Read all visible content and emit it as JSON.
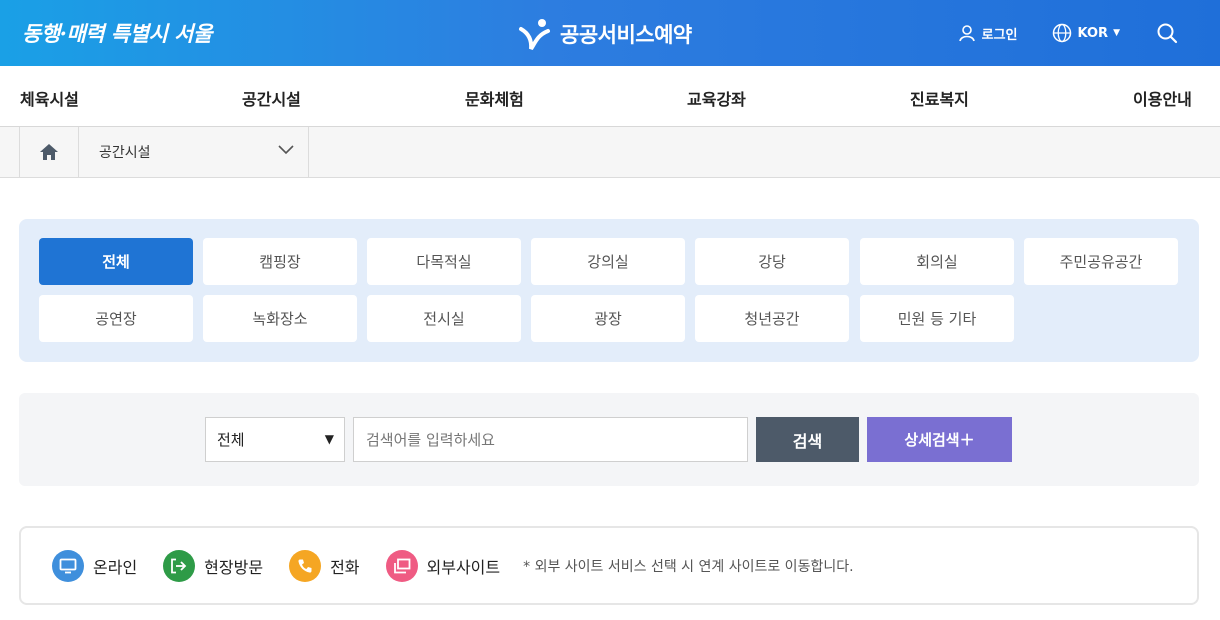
{
  "header": {
    "slogan": "동행·매력 특별시 서울",
    "brand": "공공서비스예약",
    "login": "로그인",
    "language": "KOR"
  },
  "gnb": [
    "체육시설",
    "공간시설",
    "문화체험",
    "교육강좌",
    "진료복지",
    "이용안내"
  ],
  "breadcrumb": {
    "current": "공간시설"
  },
  "categories": {
    "row1": [
      "전체",
      "캠핑장",
      "다목적실",
      "강의실",
      "강당",
      "회의실",
      "주민공유공간"
    ],
    "row2": [
      "공연장",
      "녹화장소",
      "전시실",
      "광장",
      "청년공간",
      "민원 등 기타"
    ],
    "active": "전체"
  },
  "search": {
    "select_value": "전체",
    "placeholder": "검색어를 입력하세요",
    "search_label": "검색",
    "detail_label": "상세검색＋"
  },
  "legend": {
    "online": "온라인",
    "visit": "현장방문",
    "phone": "전화",
    "external": "외부사이트",
    "note": "* 외부 사이트 서비스 선택 시 연계 사이트로 이동합니다."
  },
  "colors": {
    "active": "#1f74d4",
    "search_btn": "#4d5a69",
    "detail_btn": "#7a6fd2",
    "online": "#3f8fdc",
    "visit": "#2e9b47",
    "phone": "#f5a623",
    "external": "#ef5b83"
  }
}
